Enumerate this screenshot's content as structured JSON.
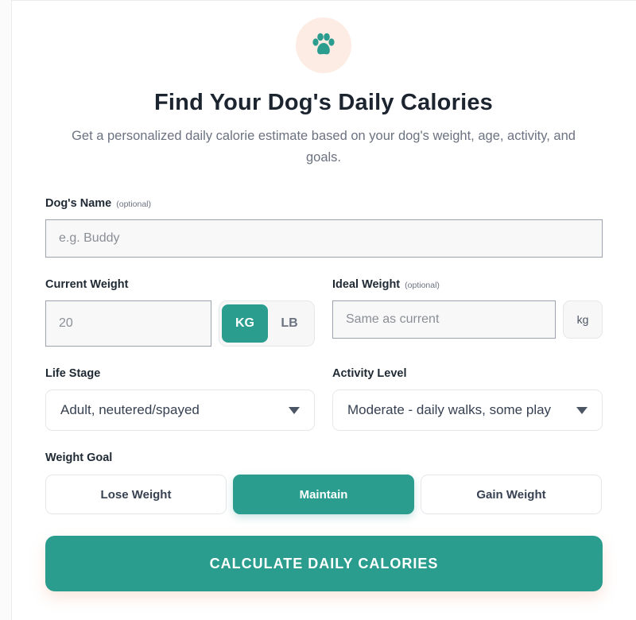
{
  "header": {
    "icon": "paw-icon",
    "title": "Find Your Dog's Daily Calories",
    "subtitle": "Get a personalized daily calorie estimate based on your dog's weight, age, activity, and goals."
  },
  "colors": {
    "accent": "#2a9d8f",
    "icon_bg": "#fdece4",
    "paw": "#2a9d8f"
  },
  "dog_name": {
    "label": "Dog's Name",
    "optional": "(optional)",
    "placeholder": "e.g. Buddy",
    "value": ""
  },
  "current_weight": {
    "label": "Current Weight",
    "placeholder": "20",
    "value": "",
    "units": [
      "KG",
      "LB"
    ],
    "selected_unit": "KG"
  },
  "ideal_weight": {
    "label": "Ideal Weight",
    "optional": "(optional)",
    "placeholder": "Same as current",
    "unit": "kg"
  },
  "life_stage": {
    "label": "Life Stage",
    "selected": "Adult, neutered/spayed"
  },
  "activity_level": {
    "label": "Activity Level",
    "selected": "Moderate - daily walks, some play"
  },
  "weight_goal": {
    "label": "Weight Goal",
    "options": [
      "Lose Weight",
      "Maintain",
      "Gain Weight"
    ],
    "selected": "Maintain"
  },
  "cta": {
    "label": "CALCULATE DAILY CALORIES"
  }
}
